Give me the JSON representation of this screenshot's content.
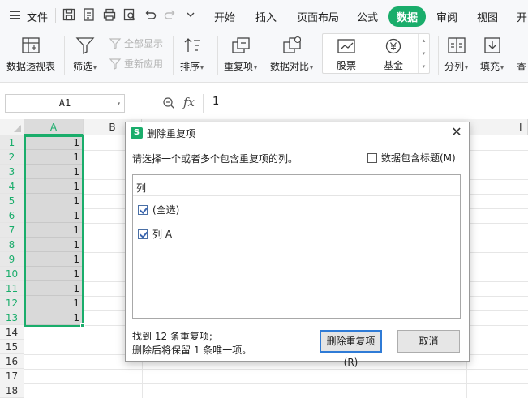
{
  "menubar": {
    "file_label": "文件",
    "tabs": [
      "开始",
      "插入",
      "页面布局",
      "公式",
      "数据",
      "审阅",
      "视图",
      "开"
    ],
    "active_tab": "数据",
    "accent_color": "#1aad6b"
  },
  "ribbon": {
    "pivot": "数据透视表",
    "filter": "筛选",
    "show_all": "全部显示",
    "reapply": "重新应用",
    "sort": "排序",
    "duplicates": "重复项",
    "compare": "数据对比",
    "stock": "股票",
    "fund": "基金",
    "split": "分列",
    "fill": "填充",
    "find": "查"
  },
  "formula_bar": {
    "name_box": "A1",
    "fx": "fx",
    "value": "1"
  },
  "grid": {
    "columns": [
      "A",
      "B",
      "I"
    ],
    "rows": [
      "1",
      "2",
      "3",
      "4",
      "5",
      "6",
      "7",
      "8",
      "9",
      "10",
      "11",
      "12",
      "13",
      "14",
      "15",
      "16",
      "17",
      "18"
    ],
    "column_a_values": [
      "1",
      "1",
      "1",
      "1",
      "1",
      "1",
      "1",
      "1",
      "1",
      "1",
      "1",
      "1",
      "1"
    ]
  },
  "dialog": {
    "title": "删除重复项",
    "logo": "S",
    "prompt": "请选择一个或者多个包含重复项的列。",
    "header_checkbox": "数据包含标题(M)",
    "header_checked": false,
    "list_header": "列",
    "items": [
      {
        "label": "(全选)",
        "checked": true
      },
      {
        "label": "列 A",
        "checked": true
      }
    ],
    "found_line1": "找到 12 条重复项;",
    "found_line2": "删除后将保留 1 条唯一项。",
    "ok": "删除重复项(R)",
    "cancel": "取消"
  }
}
